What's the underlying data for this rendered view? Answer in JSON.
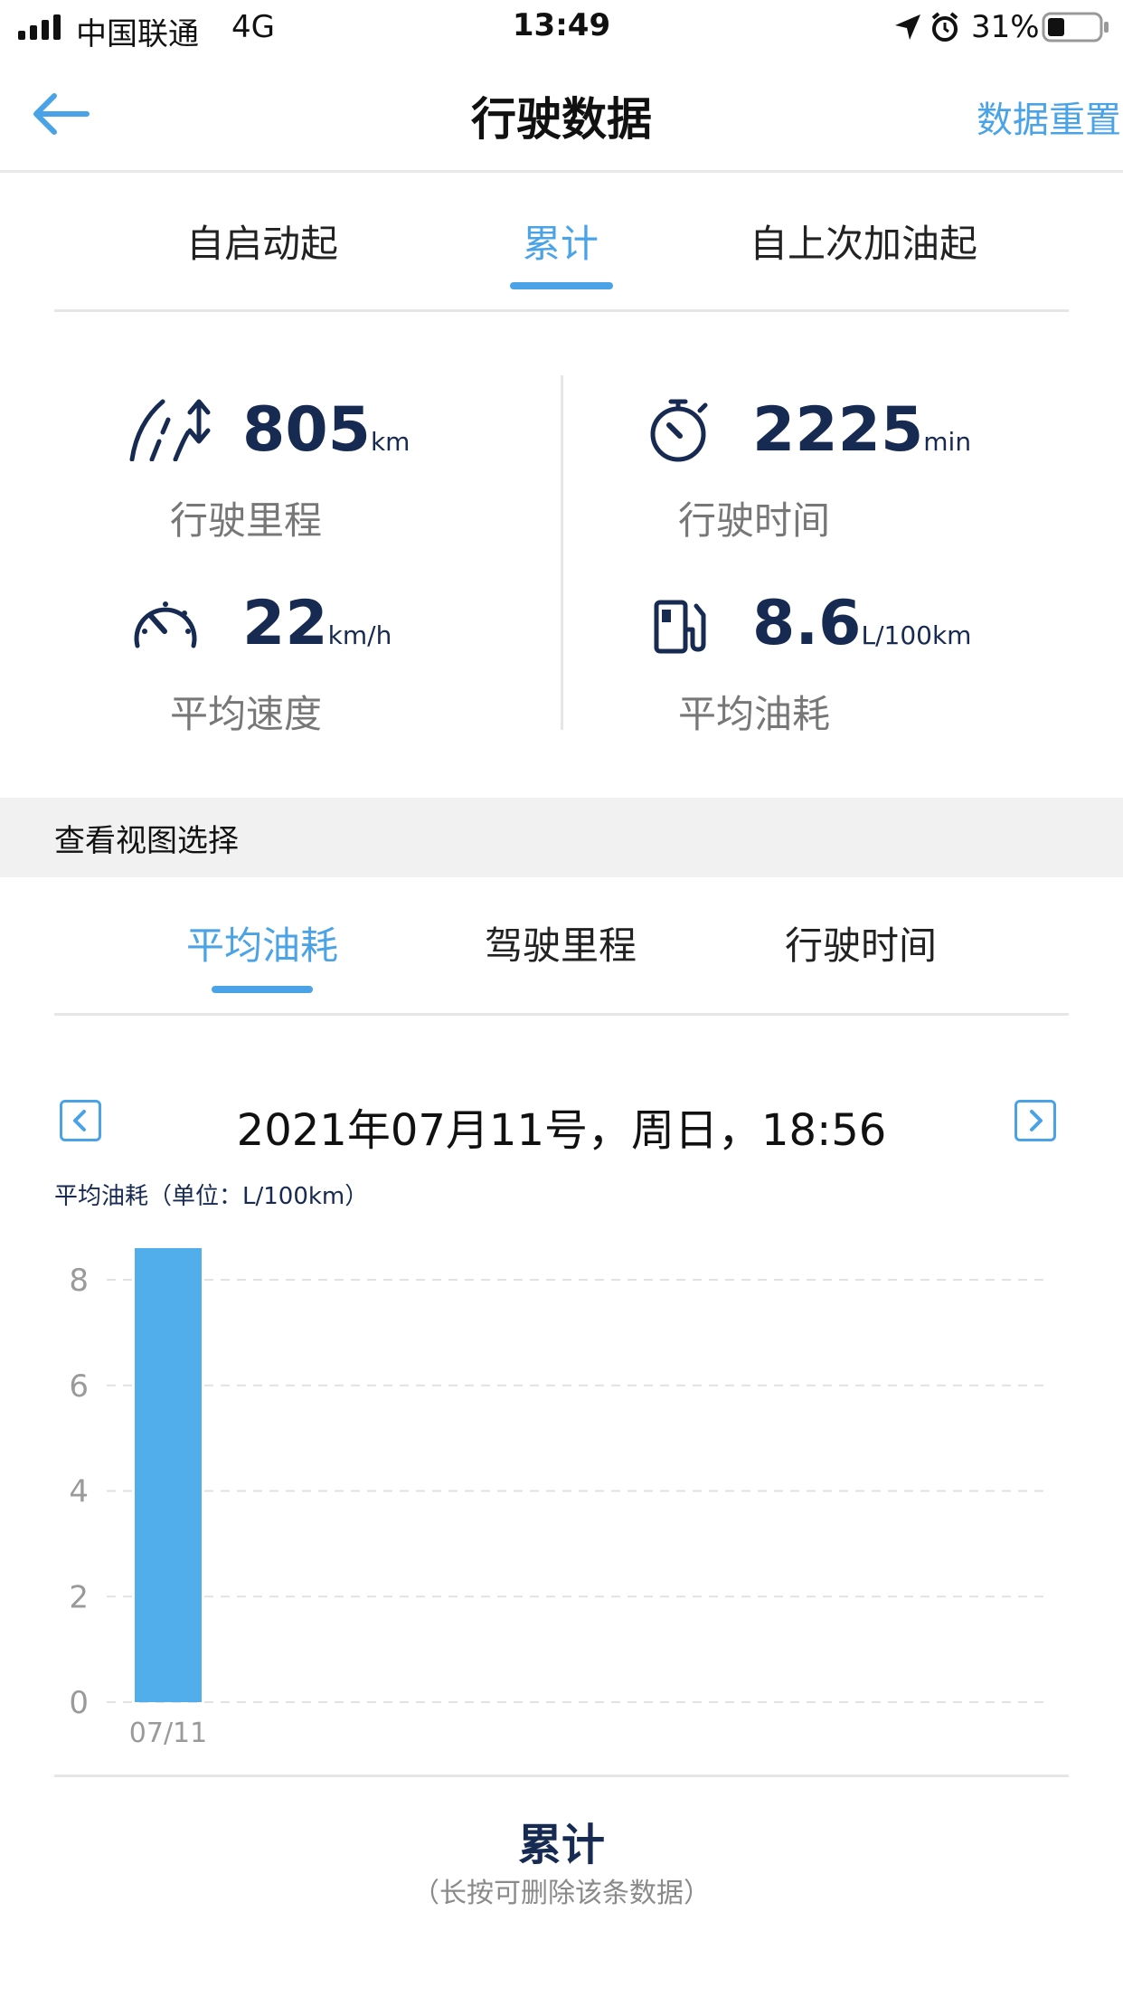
{
  "status_bar": {
    "carrier": "中国联通",
    "network": "4G",
    "time": "13:49",
    "battery": "31%"
  },
  "nav": {
    "title": "行驶数据",
    "reset_label": "数据重置"
  },
  "period_tabs": {
    "items": [
      "自启动起",
      "累计",
      "自上次加油起"
    ],
    "active": "累计"
  },
  "stats": {
    "distance": {
      "value": "805",
      "unit": "km",
      "label": "行驶里程"
    },
    "time": {
      "value": "2225",
      "unit": "min",
      "label": "行驶时间"
    },
    "speed": {
      "value": "22",
      "unit": "km/h",
      "label": "平均速度"
    },
    "fuel": {
      "value": "8.6",
      "unit": "L/100km",
      "label": "平均油耗"
    }
  },
  "view_section": {
    "title": "查看视图选择"
  },
  "view_tabs": {
    "items": [
      "平均油耗",
      "驾驶里程",
      "行驶时间"
    ],
    "active": "平均油耗"
  },
  "date_nav": {
    "text": "2021年07月11号，周日，18:56"
  },
  "chart_title": "平均油耗（单位：L/100km）",
  "chart_data": {
    "type": "bar",
    "categories": [
      "07/11"
    ],
    "values": [
      8.6
    ],
    "title": "平均油耗（单位：L/100km）",
    "xlabel": "",
    "ylabel": "",
    "ylim": [
      0,
      8.6
    ],
    "yticks": [
      0,
      2,
      4,
      6,
      8
    ],
    "grid": true,
    "bar_color": "#52aeea"
  },
  "footer": {
    "title": "累计",
    "note": "（长按可删除该条数据）"
  },
  "colors": {
    "accent": "#4aa3e6",
    "stat_text": "#172a52"
  }
}
